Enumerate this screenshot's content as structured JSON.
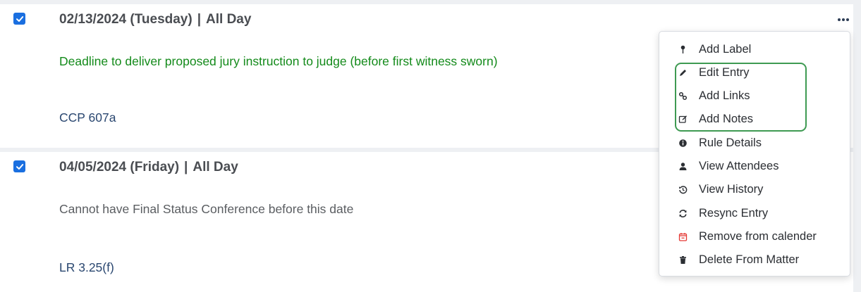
{
  "entries": [
    {
      "checked": true,
      "date": "02/13/2024 (Tuesday)",
      "separator": "|",
      "time": "All Day",
      "description": "Deadline to deliver proposed jury instruction to judge (before first witness sworn)",
      "description_color": "#138a1a",
      "rule": "CCP 607a"
    },
    {
      "checked": true,
      "date": "04/05/2024 (Friday)",
      "separator": "|",
      "time": "All Day",
      "description": "Cannot have Final Status Conference before this date",
      "description_color": "#5a5d61",
      "rule": "LR 3.25(f)"
    }
  ],
  "menu": {
    "items": [
      {
        "label": "Add Label",
        "icon": "pin-icon"
      },
      {
        "label": "Edit Entry",
        "icon": "pencil-icon"
      },
      {
        "label": "Add Links",
        "icon": "link-icon"
      },
      {
        "label": "Add Notes",
        "icon": "note-edit-icon"
      },
      {
        "label": "Rule Details",
        "icon": "info-icon"
      },
      {
        "label": "View Attendees",
        "icon": "user-icon"
      },
      {
        "label": "View History",
        "icon": "history-icon"
      },
      {
        "label": "Resync Entry",
        "icon": "sync-icon"
      },
      {
        "label": "Remove from calender",
        "icon": "calendar-remove-icon",
        "icon_color": "#e53935"
      },
      {
        "label": "Delete From Matter",
        "icon": "trash-icon"
      }
    ],
    "highlighted_items": [
      "Edit Entry",
      "Add Links",
      "Add Notes"
    ],
    "highlight_color": "#3e9a52"
  },
  "colors": {
    "checkbox": "#1a6fe0",
    "header_text": "#4a4d52",
    "rule_link": "#2a4770"
  }
}
